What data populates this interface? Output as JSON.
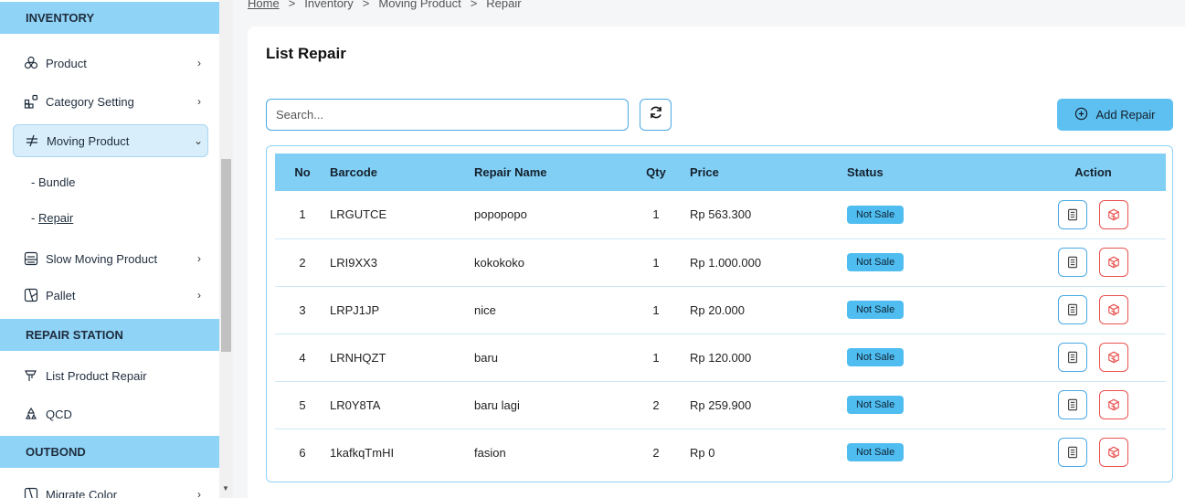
{
  "sidebar": {
    "sections": [
      {
        "title": "INVENTORY"
      },
      {
        "title": "REPAIR STATION"
      },
      {
        "title": "OUTBOND"
      }
    ],
    "items": [
      {
        "label": "Product",
        "icon": "cubes-icon"
      },
      {
        "label": "Category Setting",
        "icon": "category-icon"
      },
      {
        "label": "Moving Product",
        "icon": "moving-icon"
      },
      {
        "label": "Slow Moving Product",
        "icon": "archive-icon"
      },
      {
        "label": "Pallet",
        "icon": "pallet-icon"
      },
      {
        "label": "List Product Repair",
        "icon": "wrench-icon"
      },
      {
        "label": "QCD",
        "icon": "recycle-icon"
      },
      {
        "label": "Migrate Color",
        "icon": "migrate-icon"
      }
    ],
    "sub_items": [
      {
        "label": "Bundle"
      },
      {
        "label": "Repair"
      }
    ]
  },
  "breadcrumb": [
    "Home",
    "Inventory",
    "Moving Product",
    "Repair"
  ],
  "page": {
    "title": "List Repair",
    "search_placeholder": "Search...",
    "add_button_label": "Add Repair"
  },
  "table": {
    "columns": [
      "No",
      "Barcode",
      "Repair Name",
      "Qty",
      "Price",
      "Status",
      "Action"
    ],
    "rows": [
      {
        "no": "1",
        "barcode": "LRGUTCE",
        "name": "popopopo",
        "qty": "1",
        "price": "Rp 563.300",
        "status": "Not Sale"
      },
      {
        "no": "2",
        "barcode": "LRI9XX3",
        "name": "kokokoko",
        "qty": "1",
        "price": "Rp 1.000.000",
        "status": "Not Sale"
      },
      {
        "no": "3",
        "barcode": "LRPJ1JP",
        "name": "nice",
        "qty": "1",
        "price": "Rp 20.000",
        "status": "Not Sale"
      },
      {
        "no": "4",
        "barcode": "LRNHQZT",
        "name": "baru",
        "qty": "1",
        "price": "Rp 120.000",
        "status": "Not Sale"
      },
      {
        "no": "5",
        "barcode": "LR0Y8TA",
        "name": "baru lagi",
        "qty": "2",
        "price": "Rp 259.900",
        "status": "Not Sale"
      },
      {
        "no": "6",
        "barcode": "1kafkqTmHI",
        "name": "fasion",
        "qty": "2",
        "price": "Rp 0",
        "status": "Not Sale"
      }
    ]
  },
  "colors": {
    "accent": "#5ec0f1",
    "section_header": "#8fd3f7",
    "delete": "#e8524f"
  }
}
